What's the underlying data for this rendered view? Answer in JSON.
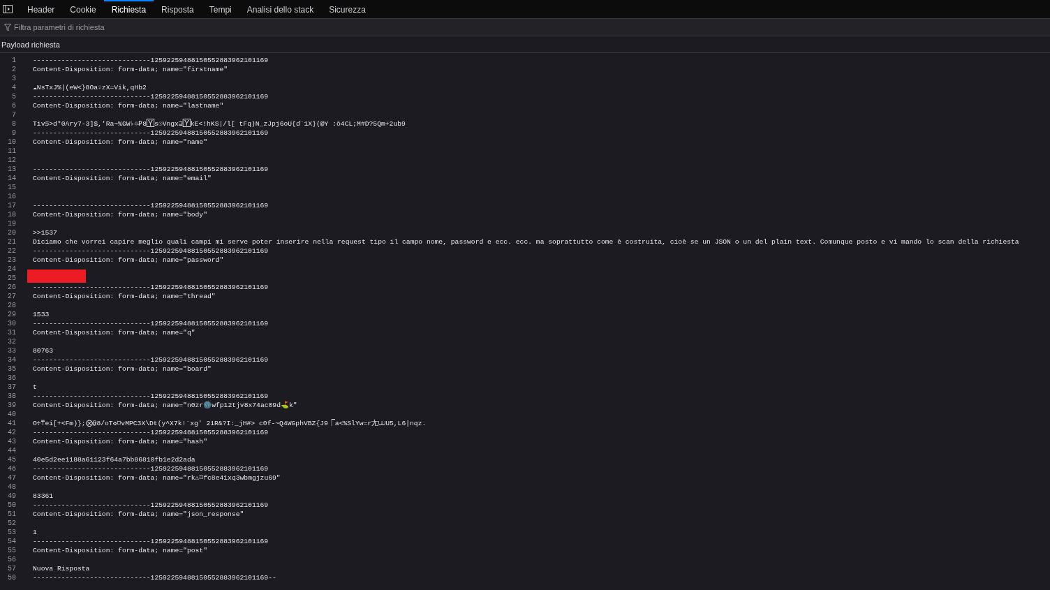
{
  "tabs": [
    {
      "label": "Header",
      "selected": false
    },
    {
      "label": "Cookie",
      "selected": false
    },
    {
      "label": "Richiesta",
      "selected": true
    },
    {
      "label": "Risposta",
      "selected": false
    },
    {
      "label": "Tempi",
      "selected": false
    },
    {
      "label": "Analisi dello stack",
      "selected": false
    },
    {
      "label": "Sicurezza",
      "selected": false
    }
  ],
  "filter": {
    "placeholder": "Filtra parametri di richiesta"
  },
  "section_title": "Payload richiesta",
  "lines": [
    {
      "n": "1",
      "text": "-----------------------------12592259488150552883962101169"
    },
    {
      "n": "2",
      "text": "Content-Disposition: form-data; name=\"firstname\""
    },
    {
      "n": "3"
    },
    {
      "n": "4",
      "text": "☁NsTxJ%|(eW<}8Oa♀zX=Vik,qHb2"
    },
    {
      "n": "5",
      "text": "-----------------------------12592259488150552883962101169"
    },
    {
      "n": "6",
      "text": "Content-Disposition: form-data; name=\"lastname\""
    },
    {
      "n": "7"
    },
    {
      "n": "8",
      "text": "Tiv♋>d*0Ary7-3]$,'Ra~%GW♭♲Ꝑ8🅈s☉Vngx⊒🅈kE<!hKS|/l[ tFq)N_zJpj6oU{ɗ`1X}(@Y :ȏ4CL;M#D?5Qm+2ub9"
    },
    {
      "n": "9",
      "text": "-----------------------------12592259488150552883962101169"
    },
    {
      "n": "10",
      "text": "Content-Disposition: form-data; name=\"name\""
    },
    {
      "n": "11"
    },
    {
      "n": "12"
    },
    {
      "n": "13",
      "text": "-----------------------------12592259488150552883962101169"
    },
    {
      "n": "14",
      "text": "Content-Disposition: form-data; name=\"email\""
    },
    {
      "n": "15"
    },
    {
      "n": "16"
    },
    {
      "n": "17",
      "text": "-----------------------------12592259488150552883962101169"
    },
    {
      "n": "18",
      "text": "Content-Disposition: form-data; name=\"body\""
    },
    {
      "n": "19"
    },
    {
      "n": "20",
      "text": ">>1537"
    },
    {
      "n": "21",
      "text": "Diciamo che vorrei capire meglio quali campi mi serve poter inserire nella request tipo il campo nome, password e ecc. ecc. ma soprattutto come è costruita, cioè se un JSON o un del plain text. Comunque posto e vi mando lo scan della richiesta"
    },
    {
      "n": "22",
      "text": "-----------------------------12592259488150552883962101169"
    },
    {
      "n": "23",
      "text": "Content-Disposition: form-data; name=\"password\""
    },
    {
      "n": "24"
    },
    {
      "n": "25",
      "kind": "redacted"
    },
    {
      "n": "26",
      "text": "-----------------------------12592259488150552883962101169"
    },
    {
      "n": "27",
      "text": "Content-Disposition: form-data; name=\"thread\""
    },
    {
      "n": "28"
    },
    {
      "n": "29",
      "text": "1533"
    },
    {
      "n": "30",
      "text": "-----------------------------12592259488150552883962101169"
    },
    {
      "n": "31",
      "text": "Content-Disposition: form-data; name=\"q\""
    },
    {
      "n": "32"
    },
    {
      "n": "33",
      "text": "80763"
    },
    {
      "n": "34",
      "text": "-----------------------------12592259488150552883962101169"
    },
    {
      "n": "35",
      "text": "Content-Disposition: form-data; name=\"board\""
    },
    {
      "n": "36"
    },
    {
      "n": "37",
      "text": "t"
    },
    {
      "n": "38",
      "text": "-----------------------------12592259488150552883962101169"
    },
    {
      "n": "39",
      "text": "Content-Disposition: form-data; name=\"n0zr🌚wfp12tjv8x74ac09d⛳k\""
    },
    {
      "n": "40"
    },
    {
      "n": "41",
      "text": "O♱⍑ei[+<Fm)};⨂@8/oT♻⌑vMPC3X\\Dt(y^X7k!`xg' 21R&?I:_jH#> c0f-~Q4WGphVBZ{J9⎾a<%SlYw=r尢⩊U5,L6|nqz."
    },
    {
      "n": "42",
      "text": "-----------------------------12592259488150552883962101169"
    },
    {
      "n": "43",
      "text": "Content-Disposition: form-data; name=\"hash\""
    },
    {
      "n": "44"
    },
    {
      "n": "45",
      "text": "40e5d2ee1188a61123f64a7bb86810fb1e2d2ada"
    },
    {
      "n": "46",
      "text": "-----------------------------12592259488150552883962101169"
    },
    {
      "n": "47",
      "text": "Content-Disposition: form-data; name=\"rk⚠⌑fc8e41xq3wbmgjzu69\""
    },
    {
      "n": "48"
    },
    {
      "n": "49",
      "text": "83361"
    },
    {
      "n": "50",
      "text": "-----------------------------12592259488150552883962101169"
    },
    {
      "n": "51",
      "text": "Content-Disposition: form-data; name=\"json_response\""
    },
    {
      "n": "52"
    },
    {
      "n": "53",
      "text": "1"
    },
    {
      "n": "54",
      "text": "-----------------------------12592259488150552883962101169"
    },
    {
      "n": "55",
      "text": "Content-Disposition: form-data; name=\"post\""
    },
    {
      "n": "56"
    },
    {
      "n": "57",
      "text": "Nuova Risposta"
    },
    {
      "n": "58",
      "text": "-----------------------------12592259488150552883962101169--"
    }
  ]
}
